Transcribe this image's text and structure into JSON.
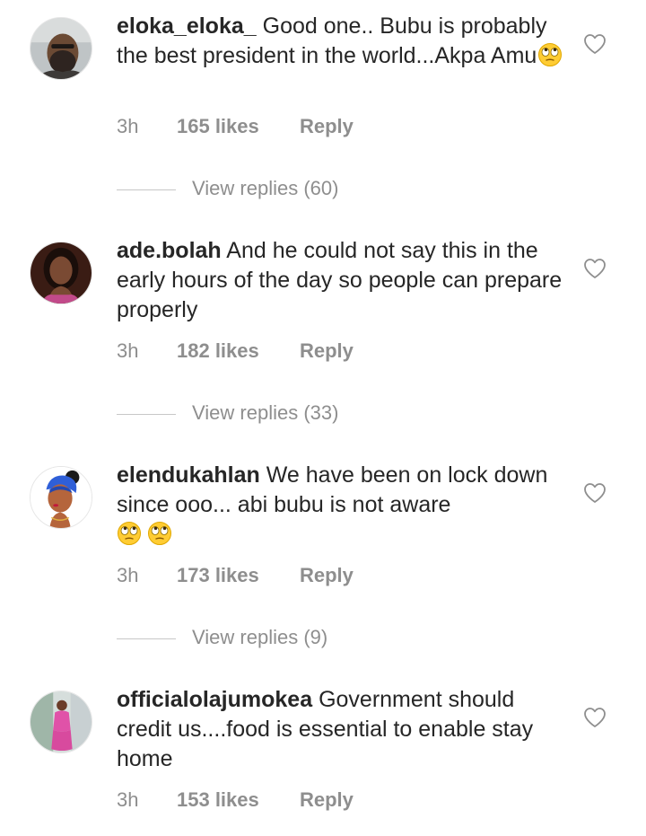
{
  "comments": [
    {
      "username": "eloka_eloka_",
      "text": "Good one.. Bubu is probably the best president in the world...Akpa Amu",
      "emoji_count": 1,
      "emoji": "face-with-rolling-eyes",
      "time": "3h",
      "likes": "165 likes",
      "reply_label": "Reply",
      "view_replies": "View replies (60)",
      "avatar_icon": "avatar-man-beard"
    },
    {
      "username": "ade.bolah",
      "text": "And he could not say this in the early hours of the day so people can prepare properly",
      "emoji_count": 0,
      "time": "3h",
      "likes": "182 likes",
      "reply_label": "Reply",
      "view_replies": "View replies (33)",
      "avatar_icon": "avatar-woman-portrait"
    },
    {
      "username": "elendukahlan",
      "text": "We have been on lock down since ooo... abi bubu is not aware",
      "emoji_count": 2,
      "emoji": "face-with-rolling-eyes",
      "time": "3h",
      "likes": "173 likes",
      "reply_label": "Reply",
      "view_replies": "View replies (9)",
      "avatar_icon": "avatar-illustrated-woman-headwrap"
    },
    {
      "username": "officialolajumokea",
      "text": "Government should credit us....food is essential to enable stay home",
      "emoji_count": 0,
      "time": "3h",
      "likes": "153 likes",
      "reply_label": "Reply",
      "avatar_icon": "avatar-woman-pink-dress"
    }
  ],
  "colors": {
    "text": "#262626",
    "secondary": "#8e8e8e",
    "divider": "#c7c7c7",
    "background": "#ffffff"
  }
}
